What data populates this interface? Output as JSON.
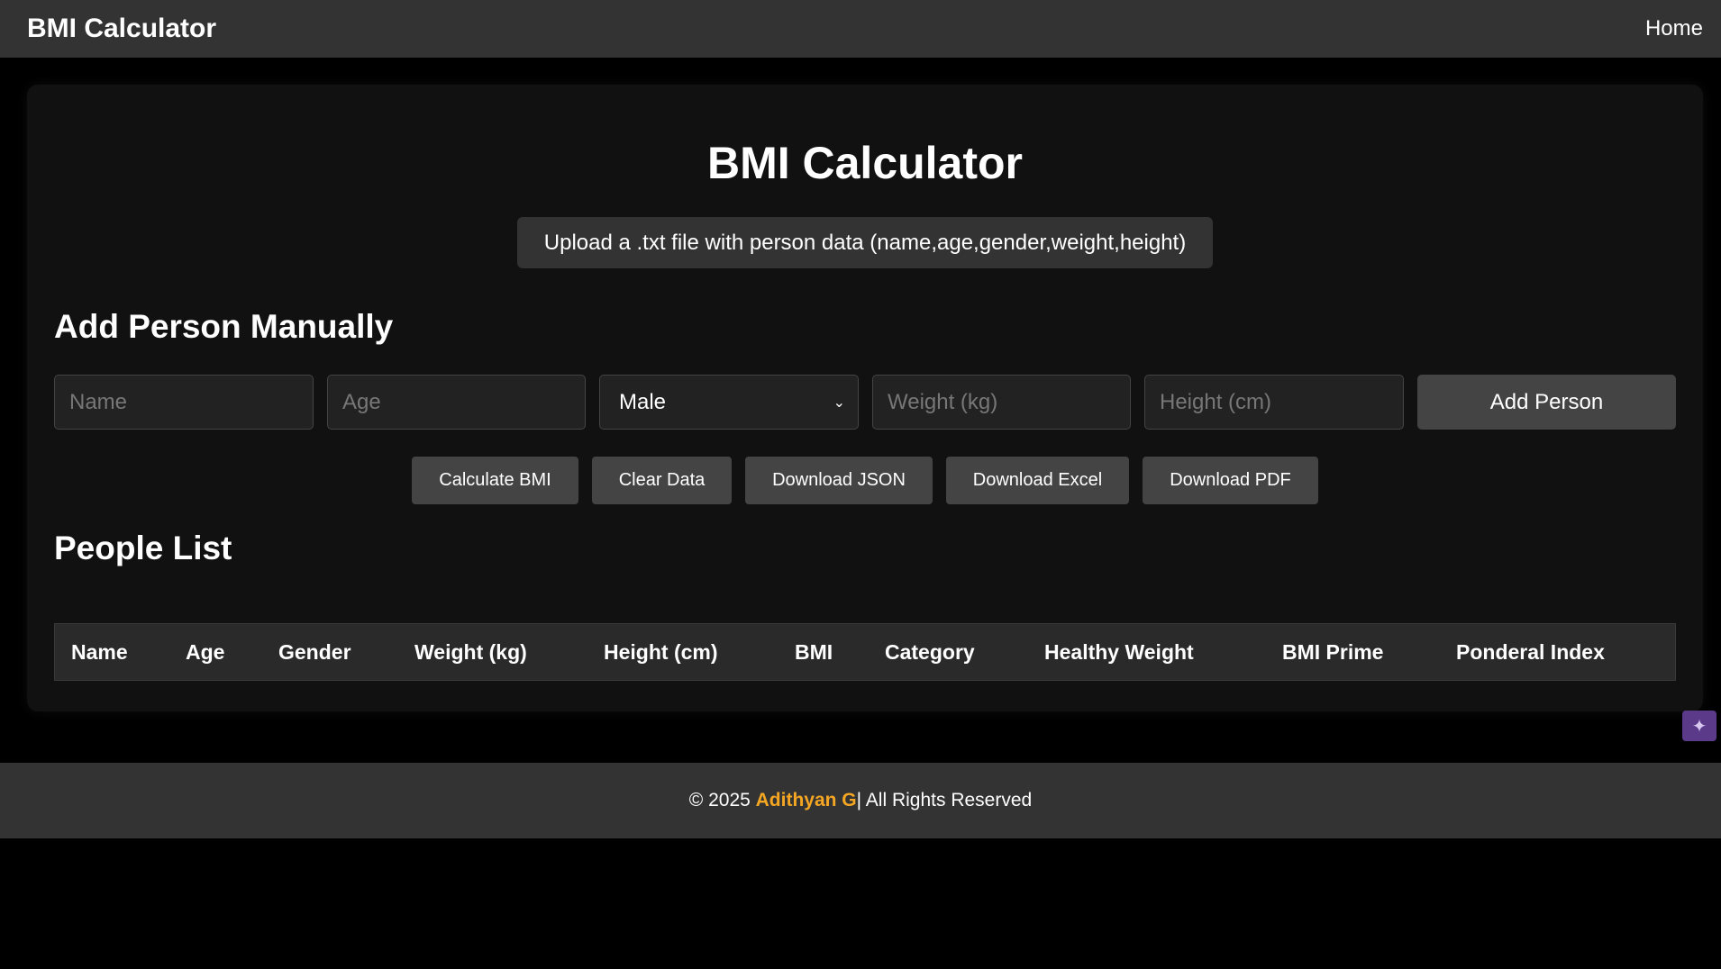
{
  "navbar": {
    "brand": "BMI Calculator",
    "home_link": "Home"
  },
  "main": {
    "title": "BMI Calculator",
    "upload_label": "Upload a .txt file with person data (name,age,gender,weight,height)",
    "add_section_title": "Add Person Manually",
    "form": {
      "name_placeholder": "Name",
      "age_placeholder": "Age",
      "gender_selected": "Male",
      "weight_placeholder": "Weight (kg)",
      "height_placeholder": "Height (cm)",
      "add_button": "Add Person"
    },
    "actions": {
      "calculate": "Calculate BMI",
      "clear": "Clear Data",
      "json": "Download JSON",
      "excel": "Download Excel",
      "pdf": "Download PDF"
    },
    "people_section_title": "People List",
    "table": {
      "columns": [
        "Name",
        "Age",
        "Gender",
        "Weight (kg)",
        "Height (cm)",
        "BMI",
        "Category",
        "Healthy Weight",
        "BMI Prime",
        "Ponderal Index"
      ]
    }
  },
  "footer": {
    "prefix": "© 2025 ",
    "author": "Adithyan G",
    "suffix": "| All Rights Reserved"
  },
  "colors": {
    "background": "#000000",
    "navbar": "#333333",
    "card": "#111111",
    "button": "#444444",
    "author_accent": "#f5a623"
  },
  "icons": {
    "assistant": "sparkle-chat-icon"
  }
}
